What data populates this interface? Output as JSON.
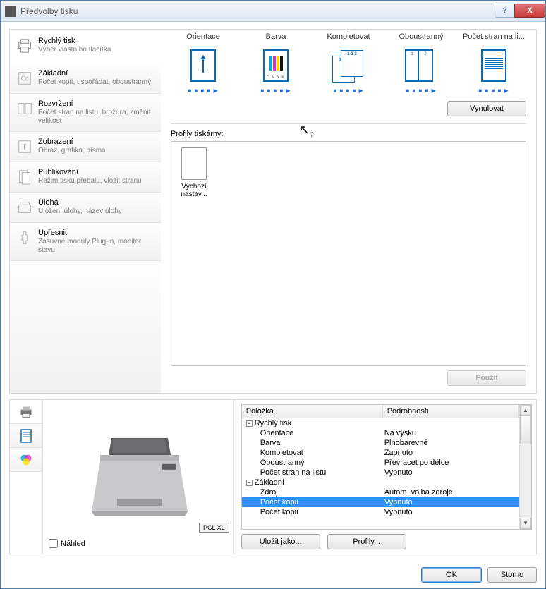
{
  "window": {
    "title": "Předvolby tisku"
  },
  "sidebar": [
    {
      "title": "Rychlý tisk",
      "sub": "Výběr vlastního tlačítka"
    },
    {
      "title": "Základní",
      "sub": "Počet kopií, uspořádat, oboustranný"
    },
    {
      "title": "Rozvržení",
      "sub": "Počet stran na listu, brožura, změnit velikost"
    },
    {
      "title": "Zobrazení",
      "sub": "Obraz, grafika, písma"
    },
    {
      "title": "Publikování",
      "sub": "Režim tisku přebalu, vložit stranu"
    },
    {
      "title": "Úloha",
      "sub": "Uložení úlohy, název úlohy"
    },
    {
      "title": "Upřesnit",
      "sub": "Zásuvné moduly Plug-in, monitor stavu"
    }
  ],
  "quick": [
    {
      "label": "Orientace"
    },
    {
      "label": "Barva"
    },
    {
      "label": "Kompletovat"
    },
    {
      "label": "Oboustranný"
    },
    {
      "label": "Počet stran na li..."
    }
  ],
  "dots": "■ ■ ■ ■ ▶",
  "buttons": {
    "reset": "Vynulovat",
    "use": "Použít",
    "saveas": "Uložit jako...",
    "profiles": "Profily...",
    "ok": "OK",
    "cancel": "Storno"
  },
  "profiles": {
    "label": "Profily tiskárny:",
    "items": [
      {
        "name": "Výchozí nastav..."
      }
    ]
  },
  "lower": {
    "badge": "PCL XL",
    "preview_chk": "Náhled",
    "headers": {
      "c1": "Položka",
      "c2": "Podrobnosti"
    },
    "groups": [
      {
        "name": "Rychlý tisk",
        "rows": [
          {
            "k": "Orientace",
            "v": "Na výšku"
          },
          {
            "k": "Barva",
            "v": "Plnobarevné"
          },
          {
            "k": "Kompletovat",
            "v": "Zapnuto"
          },
          {
            "k": "Oboustranný",
            "v": "Převracet po délce"
          },
          {
            "k": "Počet stran na listu",
            "v": "Vypnuto"
          }
        ]
      },
      {
        "name": "Základní",
        "rows": [
          {
            "k": "Zdroj",
            "v": "Autom. volba zdroje"
          },
          {
            "k": "Počet kopií",
            "v": "Vypnuto",
            "sel": true
          },
          {
            "k": "Počet kopií",
            "v": "Vypnuto"
          }
        ]
      }
    ]
  }
}
